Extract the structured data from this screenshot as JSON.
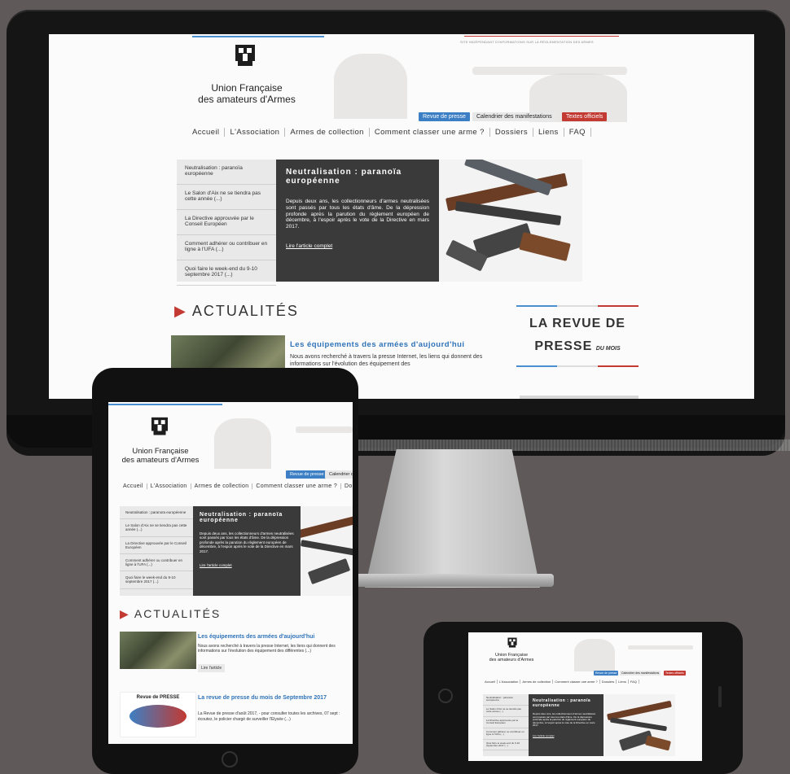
{
  "site": {
    "org_line1": "Union Française",
    "org_line2": "des amateurs d'Armes",
    "tagline": "SITE INDÉPENDANT D'INFORMATIONS SUR LA RÉGLEMENTATION DES ARMES",
    "top_buttons": [
      "Revue de presse",
      "Calendrier des manifestations",
      "Textes officiels"
    ],
    "nav": [
      "Accueil",
      "L'Association",
      "Armes de collection",
      "Comment classer une arme ?",
      "Dossiers",
      "Liens",
      "FAQ"
    ],
    "feature_list": [
      "Neutralisation : paranoïa européenne",
      "Le Salon d'Aix ne se tiendra pas cette année (...)",
      "La Directive approuvée par le Conseil Européen",
      "Comment adhérer ou contribuer en ligne à l'UFA (...)",
      "Quoi faire le week-end du 9-10 septembre 2017 (...)"
    ],
    "feature_title": "Neutralisation : paranoïa européenne",
    "feature_text": "Depuis deux ans, les collectionneurs d'armes neutralisées sont passés par tous les états d'âme. De la dépression profonde après la parution du règlement européen de décembre, à l'espoir après le vote de la Directive en mars 2017.",
    "feature_link": "Lire l'article complet",
    "section_title": "ACTUALITÉS",
    "article1_title": "Les équipements des armées d'aujourd'hui",
    "article1_text": "Nous avons recherché à travers la presse Internet, les liens qui donnent des informations sur l'évolution des équipement des différentes (...)",
    "article1_text_short": "Nous avons recherché à travers la presse Internet, les liens qui donnent des informations sur l'évolution des équipement des",
    "read_article": "Lire l'article",
    "revue_line1": "LA REVUE DE",
    "revue_line2": "PRESSE",
    "revue_sub": "DU MOIS",
    "article2_title": "La revue de presse du mois de Septembre 2017",
    "article2_text": "La Revue de presse d'août 2017, - pour consulter toutes les archives, 07 sept : écoutez, le policier chargé de surveiller l'Elysée (...)",
    "revue_thumb_label": "Revue de PRESSE"
  },
  "colors": {
    "accent_blue": "#3d7fc4",
    "accent_red": "#c23a32",
    "dark_panel": "#3a3a3a",
    "background": "#5f5959"
  }
}
